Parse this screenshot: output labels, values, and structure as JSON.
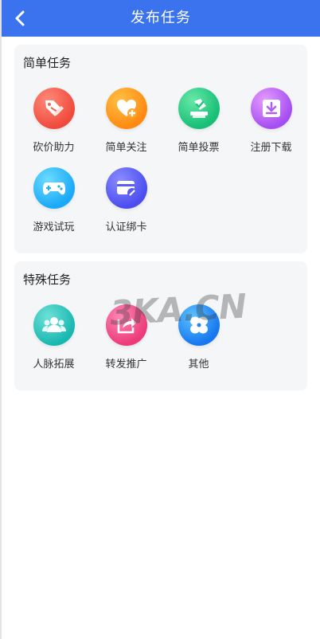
{
  "header": {
    "title": "发布任务",
    "bg_color": "#3b73ee",
    "back_icon": "chevron-left-icon"
  },
  "sections": [
    {
      "title": "简单任务",
      "items": [
        {
          "label": "砍价助力",
          "icon": "tag-slash-icon",
          "color": "#f04a3c"
        },
        {
          "label": "简单关注",
          "icon": "heart-plus-icon",
          "color": "#ff8a12"
        },
        {
          "label": "简单投票",
          "icon": "ballot-box-check-icon",
          "color": "#17bf77"
        },
        {
          "label": "注册下载",
          "icon": "download-icon",
          "color": "#a64ef2"
        },
        {
          "label": "游戏试玩",
          "icon": "gamepad-icon",
          "color": "#19a9f6"
        },
        {
          "label": "认证绑卡",
          "icon": "bank-card-link-icon",
          "color": "#4b4df0"
        }
      ]
    },
    {
      "title": "特殊任务",
      "items": [
        {
          "label": "人脉拓展",
          "icon": "people-icon",
          "color": "#18b8b0"
        },
        {
          "label": "转发推广",
          "icon": "share-icon",
          "color": "#ec3b79"
        },
        {
          "label": "其他",
          "icon": "four-petals-icon",
          "color": "#1677f0"
        }
      ]
    }
  ],
  "watermark": "3KA.CN"
}
